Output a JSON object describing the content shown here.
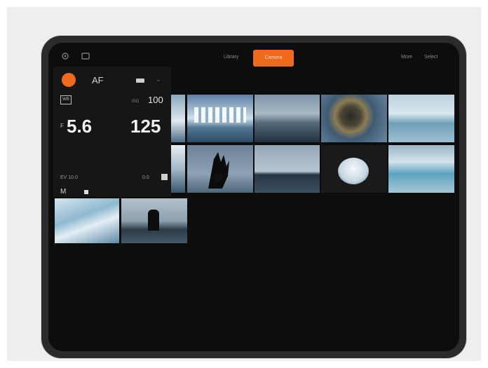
{
  "topbar": {
    "left_icons": [
      "settings-icon",
      "grid-icon"
    ],
    "segment_left": "Library",
    "segment_active": "Camera",
    "right_items": [
      "More",
      "Select"
    ]
  },
  "camera": {
    "af_label": "AF",
    "wb_label": "WB",
    "iso_label": "ISO",
    "iso_value": "100",
    "f_prefix": "F",
    "aperture": "5.6",
    "shutter": "125",
    "ev_left": "EV 10.0",
    "ev_right": "0.0",
    "mode": "M",
    "accent": "#ef6a1c"
  },
  "gallery": {
    "rows": 3,
    "photos_in_view": 11
  }
}
